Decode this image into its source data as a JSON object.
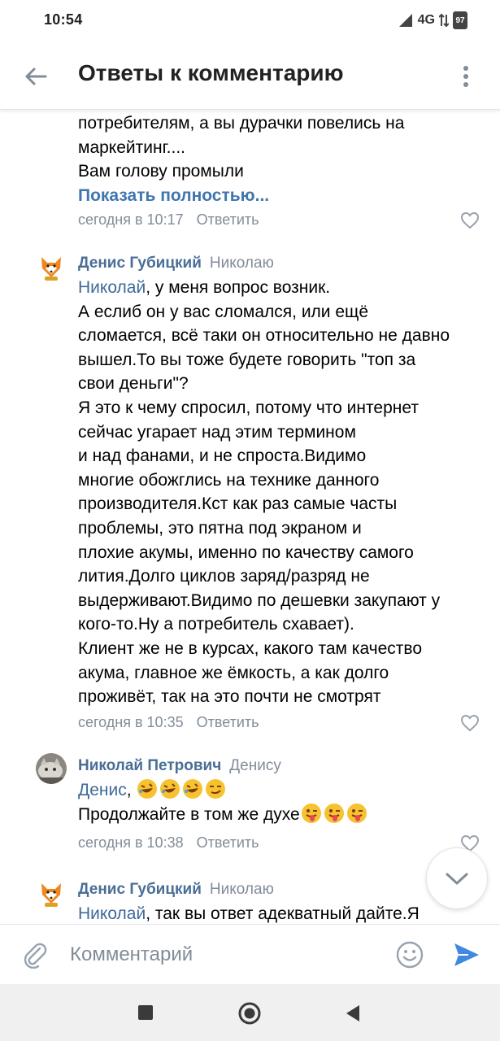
{
  "status_bar": {
    "time": "10:54",
    "network": "4G",
    "battery": "97"
  },
  "header": {
    "title": "Ответы к комментарию"
  },
  "comments": [
    {
      "lines": [
        "потребителям, а вы дурачки повелись на",
        "маркейтинг....",
        "Вам голову промыли"
      ],
      "show_more": "Показать полностью...",
      "time": "сегодня в 10:17",
      "reply_label": "Ответить"
    },
    {
      "author": "Денис Губицкий",
      "reply_to": "Николаю",
      "mention": "Николай",
      "lines": [
        ", у меня вопрос возник.",
        "А еслиб он у вас сломался, или ещё",
        "сломается, всё таки он относительно не давно",
        "вышел.То вы тоже будете говорить \"топ за",
        "свои деньги\"?",
        "Я это к чему спросил, потому что интернет",
        "сейчас угарает над этим термином",
        "и над фанами, и не спроста.Видимо",
        "многие обожглись на технике данного",
        "производителя.Кст как раз самые часты",
        "проблемы, это пятна под экраном и",
        "плохие акумы, именно по качеству самого",
        "лития.Долго циклов заряд/разряд не",
        "выдерживают.Видимо по дешевки закупают у",
        "кого-то.Ну а потребитель схавает).",
        "Клиент же не в курсах, какого там качество",
        "акума, главное же ёмкость, а как долго",
        "проживёт, так на это почти не смотрят"
      ],
      "time": "сегодня в 10:35",
      "reply_label": "Ответить"
    },
    {
      "author": "Николай Петрович",
      "reply_to": "Денису",
      "mention": "Денис",
      "lines": [
        ",",
        "Продолжайте в том же духе"
      ],
      "time": "сегодня в 10:38",
      "reply_label": "Ответить"
    },
    {
      "author": "Денис Губицкий",
      "reply_to": "Николаю",
      "mention": "Николай",
      "lines": [
        ", так вы ответ адекватный дайте.Я"
      ]
    }
  ],
  "composer": {
    "placeholder": "Комментарий"
  },
  "colors": {
    "link": "#4a6e96",
    "meta": "#818c99",
    "send": "#3f8ae0"
  },
  "icons": [
    "back-arrow-icon",
    "more-vertical-icon",
    "heart-icon",
    "chevron-down-icon",
    "paperclip-icon",
    "smiley-icon",
    "send-icon",
    "stop-square-icon",
    "home-circle-icon",
    "back-triangle-icon"
  ]
}
